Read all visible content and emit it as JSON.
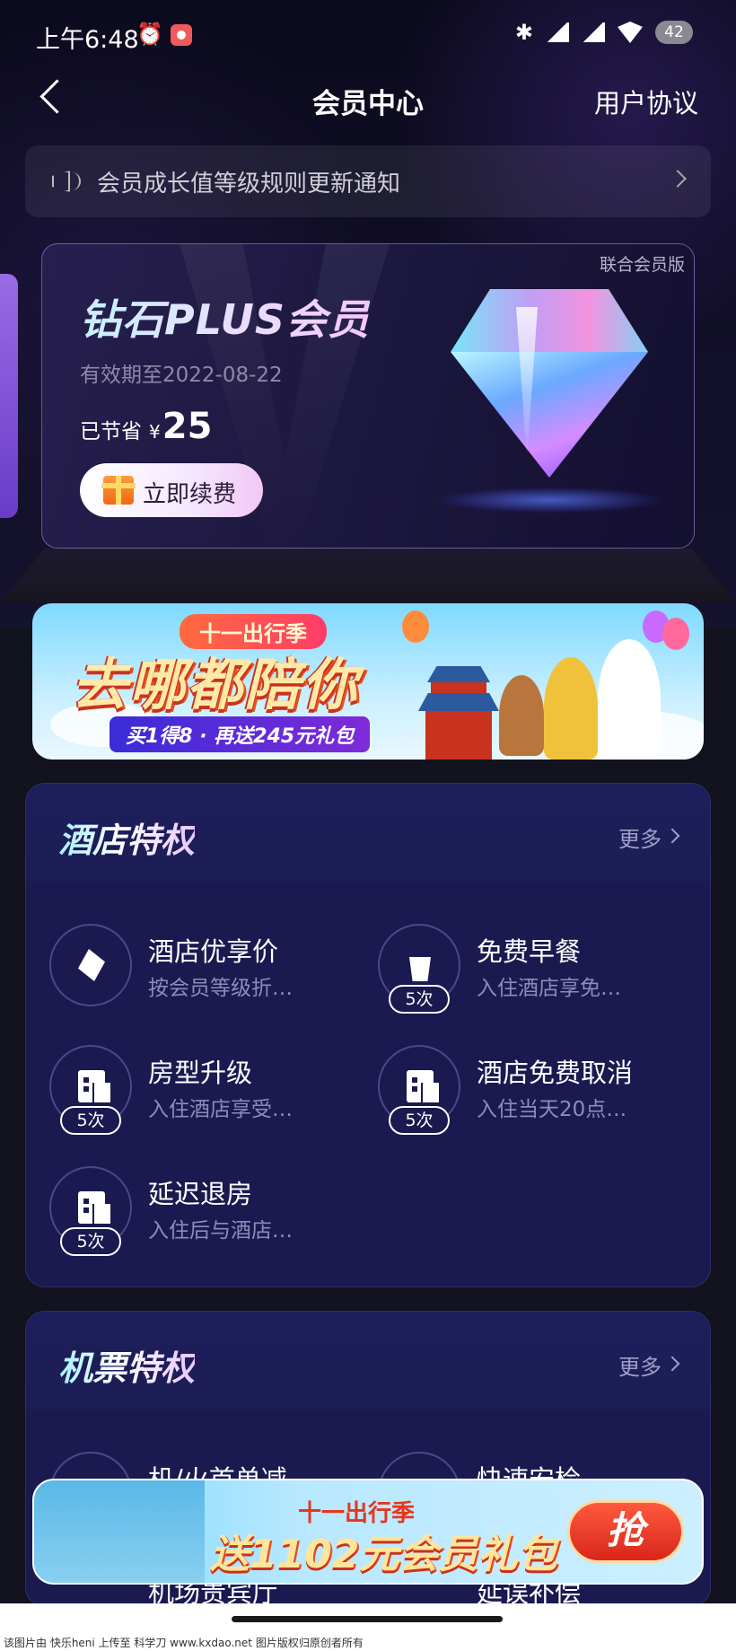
{
  "status_bar": {
    "time": "上午6:48",
    "battery": "42"
  },
  "nav": {
    "title": "会员中心",
    "right_link": "用户协议"
  },
  "notice": {
    "text": "会员成长值等级规则更新通知"
  },
  "member_card": {
    "tag": "联合会员版",
    "title": "钻石PLUS会员",
    "expire": "有效期至2022-08-22",
    "saved_label": "已节省",
    "currency": "¥",
    "saved_amount": "25",
    "renew_button": "立即续费"
  },
  "promo_banner": {
    "season": "十一出行季",
    "headline": "去哪都陪你",
    "sub": "买1得8 · 再送245元礼包"
  },
  "hotel_privileges": {
    "title": "酒店特权",
    "more": "更多",
    "items": [
      {
        "name": "酒店优享价",
        "desc": "按会员等级折…",
        "badge": "",
        "icon": "price-tag-icon"
      },
      {
        "name": "免费早餐",
        "desc": "入住酒店享免…",
        "badge": "5次",
        "icon": "breakfast-icon"
      },
      {
        "name": "房型升级",
        "desc": "入住酒店享受…",
        "badge": "5次",
        "icon": "building-icon"
      },
      {
        "name": "酒店免费取消",
        "desc": "入住当天20点…",
        "badge": "5次",
        "icon": "building-icon"
      },
      {
        "name": "延迟退房",
        "desc": "入住后与酒店…",
        "badge": "5次",
        "icon": "building-icon"
      }
    ]
  },
  "flight_privileges": {
    "title": "机票特权",
    "more": "更多",
    "items": [
      {
        "name": "机/火首单减"
      },
      {
        "name": "快速安检"
      },
      {
        "name": "机场贵宾厅"
      },
      {
        "name": "延误补偿"
      }
    ]
  },
  "float_banner": {
    "season": "十一出行季",
    "headline": "送1102元会员礼包",
    "button": "抢"
  },
  "watermark": "该图片由 快乐heni 上传至 科学刀 www.kxdao.net 图片版权归原创者所有"
}
